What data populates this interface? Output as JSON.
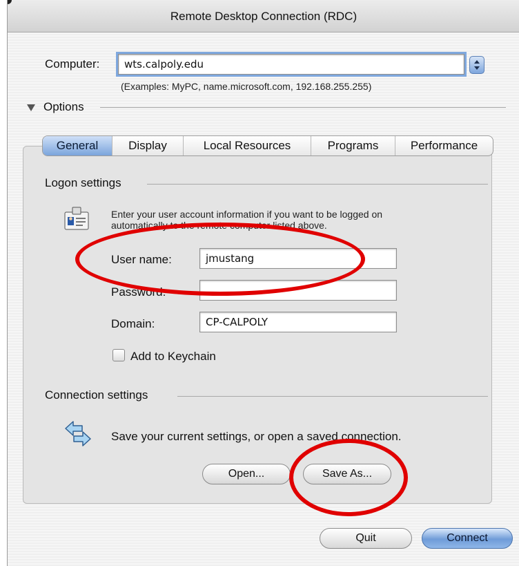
{
  "window": {
    "title": "Remote Desktop Connection (RDC)"
  },
  "computer": {
    "label": "Computer:",
    "value": "wts.calpoly.edu",
    "examples": "(Examples: MyPC, name.microsoft.com, 192.168.255.255)"
  },
  "options": {
    "label": "Options"
  },
  "tabs": [
    {
      "label": "General",
      "active": true
    },
    {
      "label": "Display",
      "active": false
    },
    {
      "label": "Local Resources",
      "active": false
    },
    {
      "label": "Programs",
      "active": false
    },
    {
      "label": "Performance",
      "active": false
    }
  ],
  "logon": {
    "heading": "Logon settings",
    "info_line1": "Enter your user account information if you want to be logged on",
    "info_line2": "automatically to the remote computer listed above.",
    "username_label": "User name:",
    "username_value": "jmustang",
    "password_label": "Password:",
    "password_value": "",
    "domain_label": "Domain:",
    "domain_value": "CP-CALPOLY",
    "keychain_label": "Add to Keychain"
  },
  "connection": {
    "heading": "Connection settings",
    "info": "Save your current settings, or open a saved connection.",
    "open_label": "Open...",
    "saveas_label": "Save As..."
  },
  "footer": {
    "quit_label": "Quit",
    "connect_label": "Connect"
  },
  "colors": {
    "highlight": "#e00000",
    "accent": "#7aa4dc"
  }
}
